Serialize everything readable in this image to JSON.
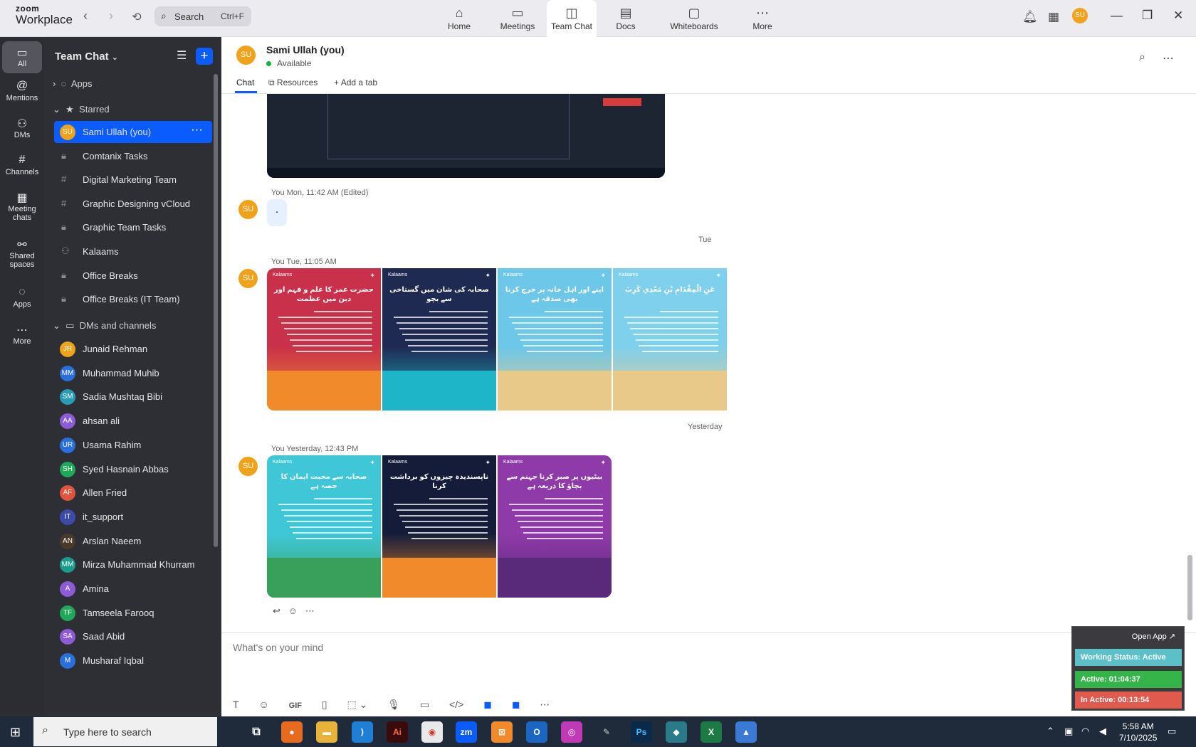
{
  "app": {
    "brand_top": "zoom",
    "brand_bottom": "Workplace"
  },
  "search": {
    "label": "Search",
    "shortcut": "Ctrl+F"
  },
  "tabs": [
    {
      "label": "Home",
      "icon": "home-icon"
    },
    {
      "label": "Meetings",
      "icon": "video-icon"
    },
    {
      "label": "Team Chat",
      "icon": "chat-icon"
    },
    {
      "label": "Docs",
      "icon": "doc-icon"
    },
    {
      "label": "Whiteboards",
      "icon": "whiteboard-icon"
    },
    {
      "label": "More",
      "icon": "more-icon"
    }
  ],
  "user_avatar": "SU",
  "rail": [
    {
      "label": "All"
    },
    {
      "label": "Mentions"
    },
    {
      "label": "DMs"
    },
    {
      "label": "Channels"
    },
    {
      "label": "Meeting chats"
    },
    {
      "label": "Shared spaces"
    },
    {
      "label": "Apps"
    },
    {
      "label": "More"
    }
  ],
  "sidebar": {
    "title": "Team Chat",
    "sections": {
      "apps": "Apps",
      "starred": "Starred",
      "dms": "DMs and channels"
    },
    "starred": [
      {
        "name": "Sami Ullah (you)",
        "avatar": "SU",
        "color": "#f0a21a"
      },
      {
        "name": "Comtanix Tasks"
      },
      {
        "name": "Digital Marketing Team"
      },
      {
        "name": "Graphic Designing vCloud"
      },
      {
        "name": "Graphic Team Tasks"
      },
      {
        "name": "Kalaams"
      },
      {
        "name": "Office Breaks"
      },
      {
        "name": "Office Breaks (IT Team)"
      }
    ],
    "dms": [
      {
        "name": "Junaid Rehman",
        "avatar": "JR",
        "color": "#f0a21a"
      },
      {
        "name": "Muhammad Muhib",
        "avatar": "MM",
        "color": "#2a6fdb"
      },
      {
        "name": "Sadia Mushtaq Bibi",
        "avatar": "SM",
        "color": "#2a9bb5"
      },
      {
        "name": "ahsan ali",
        "avatar": "AA",
        "color": "#8e5bd6"
      },
      {
        "name": "Usama Rahim",
        "avatar": "UR",
        "color": "#2a6fdb"
      },
      {
        "name": "Syed Hasnain Abbas",
        "avatar": "SH",
        "color": "#1fa85a"
      },
      {
        "name": "Allen Fried",
        "avatar": "AF",
        "color": "#e0533c"
      },
      {
        "name": "it_support",
        "avatar": "IT",
        "color": "#3c4ba8"
      },
      {
        "name": "Arslan Naeem",
        "avatar": "AN",
        "color": "#4a3a2a"
      },
      {
        "name": "Mirza Muhammad Khurram",
        "avatar": "MM",
        "color": "#1a9c8c"
      },
      {
        "name": "Amina",
        "avatar": "A",
        "color": "#8e5bd6"
      },
      {
        "name": "Tamseela Farooq",
        "avatar": "TF",
        "color": "#1fa85a"
      },
      {
        "name": "Saad Abid",
        "avatar": "SA",
        "color": "#8e5bd6"
      },
      {
        "name": "Musharaf Iqbal",
        "avatar": "M",
        "color": "#2a6fdb"
      }
    ]
  },
  "chat": {
    "name": "Sami Ullah (you)",
    "status": "Available",
    "tabs": {
      "chat": "Chat",
      "resources": "Resources",
      "add": "Add a tab"
    },
    "messages": [
      {
        "meta": "You Mon, 11:42 AM (Edited)",
        "text": "."
      },
      {
        "meta": "You Tue, 11:05 AM"
      },
      {
        "meta": "You Yesterday, 12:43 PM"
      }
    ],
    "days": [
      "Tue",
      "Yesterday"
    ],
    "composer_placeholder": "What's on your mind"
  },
  "cards_row1": [
    {
      "brand": "Kalaams",
      "title": "حضرت عمر کا علم و فہم اور دین میں عظمت",
      "top": "#c9304a",
      "bottom": "#f08a2a"
    },
    {
      "brand": "Kalaams",
      "title": "صحابہ کی شان میں گستاخی سے بچو",
      "top": "#1e2a52",
      "bottom": "#1fb5c9"
    },
    {
      "brand": "Kalaams",
      "title": "اپنے اور اہل خانہ پر خرچ کرنا بھی صدقہ ہے",
      "top": "#6cc7e8",
      "bottom": "#e9c98a"
    },
    {
      "brand": "Kalaams",
      "title": "عَنِ الْمِقْدَامِ بْنِ مَعْدِي كَرِبَ",
      "top": "#7fd0ec",
      "bottom": "#e9c98a"
    }
  ],
  "cards_row2": [
    {
      "brand": "Kalaams",
      "title": "صحابہ سے محبت ایمان کا حصہ ہے",
      "top": "#3fc7d8",
      "bottom": "#38a05a"
    },
    {
      "brand": "Kalaams",
      "title": "ناپسندیدہ چیزوں کو برداشت کرنا",
      "top": "#141c3a",
      "bottom": "#f08a2a"
    },
    {
      "brand": "Kalaams",
      "title": "بیٹیوں پر صبر کرنا جہنم سے بچاؤ کا ذریعہ ہے",
      "top": "#8e3aa8",
      "bottom": "#5a2a7a"
    }
  ],
  "widget": {
    "open": "Open App ↗",
    "status": "Working Status: Active",
    "active": "Active: 01:04:37",
    "inactive": "In Active: 00:13:54",
    "colors": {
      "status": "#5bc0c8",
      "active": "#35b44a",
      "inactive": "#e05a4e"
    }
  },
  "taskbar": {
    "search": "Type here to search",
    "time": "5:58 AM",
    "date": "7/10/2025"
  }
}
